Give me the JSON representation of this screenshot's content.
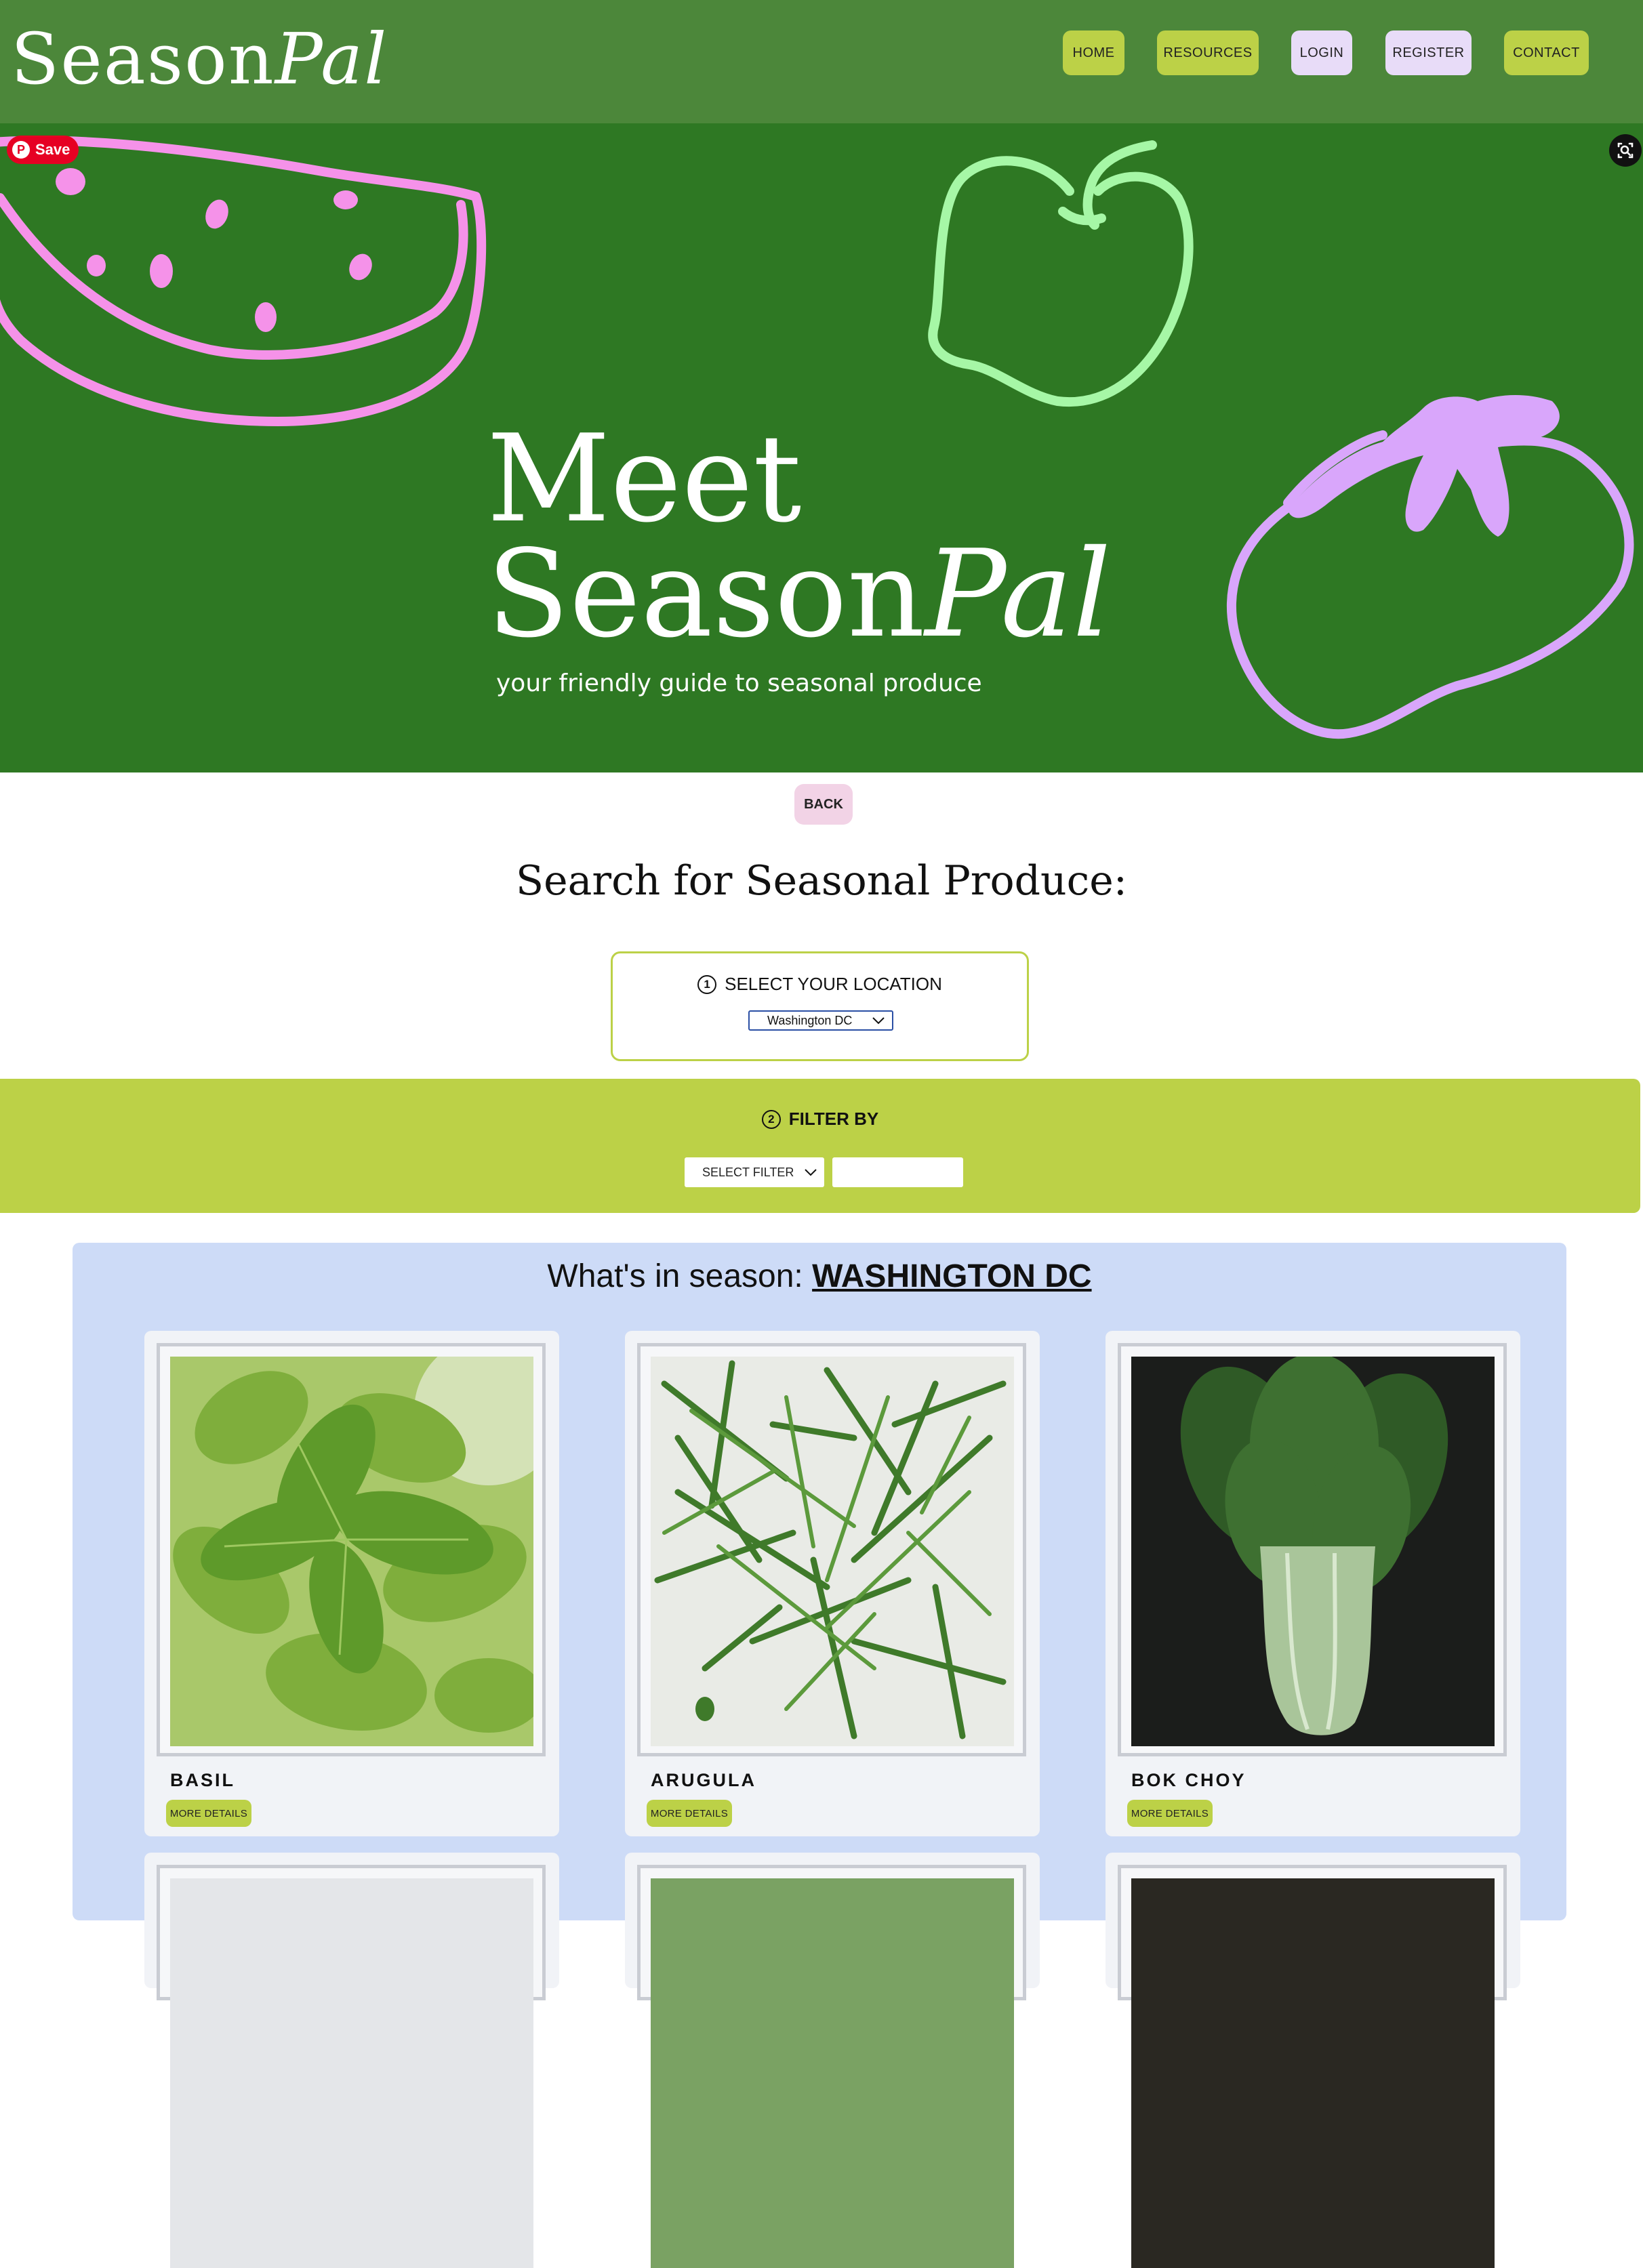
{
  "header": {
    "logo": {
      "part1": "Season",
      "part2": "Pal"
    },
    "nav": [
      {
        "label": "HOME",
        "color": "#bcd147"
      },
      {
        "label": "RESOURCES",
        "color": "#bcd147"
      },
      {
        "label": "LOGIN",
        "color": "#e8dcf8"
      },
      {
        "label": "REGISTER",
        "color": "#e8dcf8"
      },
      {
        "label": "CONTACT",
        "color": "#bcd147"
      }
    ]
  },
  "hero": {
    "save_label": "Save",
    "title_line1": "Meet",
    "title_part1": "Season",
    "title_part2": "Pal",
    "subtitle": "your friendly guide to seasonal produce",
    "icons": [
      "watermelon-doodle",
      "apple-doodle",
      "tomato-doodle",
      "pinterest-icon",
      "visual-search-icon"
    ]
  },
  "back_label": "BACK",
  "search": {
    "title": "Search for Seasonal Produce:",
    "step1": {
      "number": "1",
      "label": "SELECT YOUR LOCATION",
      "selected": "Washington DC"
    },
    "step2": {
      "number": "2",
      "label": "FILTER BY",
      "filter_selected": "SELECT FILTER",
      "filter_text": ""
    }
  },
  "results": {
    "heading_prefix": "What's in season: ",
    "city": "WASHINGTON DC",
    "items": [
      {
        "name": "BASIL",
        "button": "MORE DETAILS",
        "image": "basil-photo"
      },
      {
        "name": "ARUGULA",
        "button": "MORE DETAILS",
        "image": "arugula-photo"
      },
      {
        "name": "BOK CHOY",
        "button": "MORE DETAILS",
        "image": "bok-choy-photo"
      }
    ]
  },
  "colors": {
    "header_bg": "#4c873a",
    "hero_bg": "#2e7823",
    "accent_green": "#bcd147",
    "accent_lilac": "#e8dcf8",
    "back_pink": "#f2d3e6",
    "results_bg": "#cddbf7"
  }
}
